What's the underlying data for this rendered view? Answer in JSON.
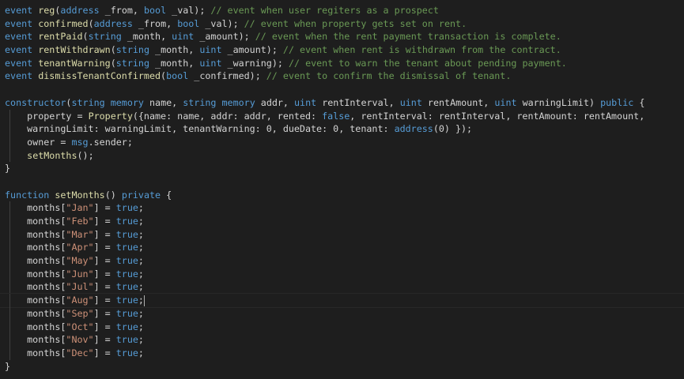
{
  "editor": {
    "lines": [
      {
        "tokens": [
          {
            "t": "event",
            "c": "kw"
          },
          {
            "t": " ",
            "c": "pl"
          },
          {
            "t": "reg",
            "c": "fn"
          },
          {
            "t": "(",
            "c": "pl"
          },
          {
            "t": "address",
            "c": "kw"
          },
          {
            "t": " _from, ",
            "c": "pl"
          },
          {
            "t": "bool",
            "c": "kw"
          },
          {
            "t": " _val); ",
            "c": "pl"
          },
          {
            "t": "// event when user regiters as a prospect",
            "c": "cm"
          }
        ]
      },
      {
        "tokens": [
          {
            "t": "event",
            "c": "kw"
          },
          {
            "t": " ",
            "c": "pl"
          },
          {
            "t": "confirmed",
            "c": "fn"
          },
          {
            "t": "(",
            "c": "pl"
          },
          {
            "t": "address",
            "c": "kw"
          },
          {
            "t": " _from, ",
            "c": "pl"
          },
          {
            "t": "bool",
            "c": "kw"
          },
          {
            "t": " _val); ",
            "c": "pl"
          },
          {
            "t": "// event when property gets set on rent.",
            "c": "cm"
          }
        ]
      },
      {
        "tokens": [
          {
            "t": "event",
            "c": "kw"
          },
          {
            "t": " ",
            "c": "pl"
          },
          {
            "t": "rentPaid",
            "c": "fn"
          },
          {
            "t": "(",
            "c": "pl"
          },
          {
            "t": "string",
            "c": "kw"
          },
          {
            "t": " _month, ",
            "c": "pl"
          },
          {
            "t": "uint",
            "c": "kw"
          },
          {
            "t": " _amount); ",
            "c": "pl"
          },
          {
            "t": "// event when the rent payment transaction is complete.",
            "c": "cm"
          }
        ]
      },
      {
        "tokens": [
          {
            "t": "event",
            "c": "kw"
          },
          {
            "t": " ",
            "c": "pl"
          },
          {
            "t": "rentWithdrawn",
            "c": "fn"
          },
          {
            "t": "(",
            "c": "pl"
          },
          {
            "t": "string",
            "c": "kw"
          },
          {
            "t": " _month, ",
            "c": "pl"
          },
          {
            "t": "uint",
            "c": "kw"
          },
          {
            "t": " _amount); ",
            "c": "pl"
          },
          {
            "t": "// event when rent is withdrawn from the contract.",
            "c": "cm"
          }
        ]
      },
      {
        "tokens": [
          {
            "t": "event",
            "c": "kw"
          },
          {
            "t": " ",
            "c": "pl"
          },
          {
            "t": "tenantWarning",
            "c": "fn"
          },
          {
            "t": "(",
            "c": "pl"
          },
          {
            "t": "string",
            "c": "kw"
          },
          {
            "t": " _month, ",
            "c": "pl"
          },
          {
            "t": "uint",
            "c": "kw"
          },
          {
            "t": " _warning); ",
            "c": "pl"
          },
          {
            "t": "// event to warn the tenant about pending payment.",
            "c": "cm"
          }
        ]
      },
      {
        "tokens": [
          {
            "t": "event",
            "c": "kw"
          },
          {
            "t": " ",
            "c": "pl"
          },
          {
            "t": "dismissTenantConfirmed",
            "c": "fn"
          },
          {
            "t": "(",
            "c": "pl"
          },
          {
            "t": "bool",
            "c": "kw"
          },
          {
            "t": " _confirmed); ",
            "c": "pl"
          },
          {
            "t": "// event to confirm the dismissal of tenant.",
            "c": "cm"
          }
        ]
      },
      {
        "tokens": []
      },
      {
        "tokens": [
          {
            "t": "constructor",
            "c": "kw"
          },
          {
            "t": "(",
            "c": "pl"
          },
          {
            "t": "string",
            "c": "kw"
          },
          {
            "t": " ",
            "c": "pl"
          },
          {
            "t": "memory",
            "c": "kw"
          },
          {
            "t": " name, ",
            "c": "pl"
          },
          {
            "t": "string",
            "c": "kw"
          },
          {
            "t": " ",
            "c": "pl"
          },
          {
            "t": "memory",
            "c": "kw"
          },
          {
            "t": " addr, ",
            "c": "pl"
          },
          {
            "t": "uint",
            "c": "kw"
          },
          {
            "t": " rentInterval, ",
            "c": "pl"
          },
          {
            "t": "uint",
            "c": "kw"
          },
          {
            "t": " rentAmount, ",
            "c": "pl"
          },
          {
            "t": "uint",
            "c": "kw"
          },
          {
            "t": " warningLimit) ",
            "c": "pl"
          },
          {
            "t": "public",
            "c": "kw"
          },
          {
            "t": " {",
            "c": "pl"
          }
        ]
      },
      {
        "indent": true,
        "tokens": [
          {
            "t": "    property = ",
            "c": "pl"
          },
          {
            "t": "Property",
            "c": "fn"
          },
          {
            "t": "({name: name, addr: addr, rented: ",
            "c": "pl"
          },
          {
            "t": "false",
            "c": "kw"
          },
          {
            "t": ", rentInterval: rentInterval, rentAmount: rentAmount,",
            "c": "pl"
          }
        ]
      },
      {
        "indent": true,
        "tokens": [
          {
            "t": "    warningLimit: warningLimit, tenantWarning: 0, dueDate: 0, tenant: ",
            "c": "pl"
          },
          {
            "t": "address",
            "c": "kw"
          },
          {
            "t": "(0) });",
            "c": "pl"
          }
        ]
      },
      {
        "indent": true,
        "tokens": [
          {
            "t": "    owner = ",
            "c": "pl"
          },
          {
            "t": "msg",
            "c": "kw"
          },
          {
            "t": ".sender;",
            "c": "pl"
          }
        ]
      },
      {
        "indent": true,
        "tokens": [
          {
            "t": "    ",
            "c": "pl"
          },
          {
            "t": "setMonths",
            "c": "fn"
          },
          {
            "t": "();",
            "c": "pl"
          }
        ]
      },
      {
        "tokens": [
          {
            "t": "}",
            "c": "pl"
          }
        ]
      },
      {
        "tokens": []
      },
      {
        "tokens": [
          {
            "t": "function",
            "c": "kw"
          },
          {
            "t": " ",
            "c": "pl"
          },
          {
            "t": "setMonths",
            "c": "fn"
          },
          {
            "t": "() ",
            "c": "pl"
          },
          {
            "t": "private",
            "c": "kw"
          },
          {
            "t": " {",
            "c": "pl"
          }
        ]
      },
      {
        "indent": true,
        "tokens": [
          {
            "t": "    months[",
            "c": "pl"
          },
          {
            "t": "\"Jan\"",
            "c": "st"
          },
          {
            "t": "] = ",
            "c": "pl"
          },
          {
            "t": "true",
            "c": "kw"
          },
          {
            "t": ";",
            "c": "pl"
          }
        ]
      },
      {
        "indent": true,
        "tokens": [
          {
            "t": "    months[",
            "c": "pl"
          },
          {
            "t": "\"Feb\"",
            "c": "st"
          },
          {
            "t": "] = ",
            "c": "pl"
          },
          {
            "t": "true",
            "c": "kw"
          },
          {
            "t": ";",
            "c": "pl"
          }
        ]
      },
      {
        "indent": true,
        "tokens": [
          {
            "t": "    months[",
            "c": "pl"
          },
          {
            "t": "\"Mar\"",
            "c": "st"
          },
          {
            "t": "] = ",
            "c": "pl"
          },
          {
            "t": "true",
            "c": "kw"
          },
          {
            "t": ";",
            "c": "pl"
          }
        ]
      },
      {
        "indent": true,
        "tokens": [
          {
            "t": "    months[",
            "c": "pl"
          },
          {
            "t": "\"Apr\"",
            "c": "st"
          },
          {
            "t": "] = ",
            "c": "pl"
          },
          {
            "t": "true",
            "c": "kw"
          },
          {
            "t": ";",
            "c": "pl"
          }
        ]
      },
      {
        "indent": true,
        "tokens": [
          {
            "t": "    months[",
            "c": "pl"
          },
          {
            "t": "\"May\"",
            "c": "st"
          },
          {
            "t": "] = ",
            "c": "pl"
          },
          {
            "t": "true",
            "c": "kw"
          },
          {
            "t": ";",
            "c": "pl"
          }
        ]
      },
      {
        "indent": true,
        "tokens": [
          {
            "t": "    months[",
            "c": "pl"
          },
          {
            "t": "\"Jun\"",
            "c": "st"
          },
          {
            "t": "] = ",
            "c": "pl"
          },
          {
            "t": "true",
            "c": "kw"
          },
          {
            "t": ";",
            "c": "pl"
          }
        ]
      },
      {
        "indent": true,
        "tokens": [
          {
            "t": "    months[",
            "c": "pl"
          },
          {
            "t": "\"Jul\"",
            "c": "st"
          },
          {
            "t": "] = ",
            "c": "pl"
          },
          {
            "t": "true",
            "c": "kw"
          },
          {
            "t": ";",
            "c": "pl"
          }
        ]
      },
      {
        "indent": true,
        "current": true,
        "cursor_after": true,
        "tokens": [
          {
            "t": "    months[",
            "c": "pl"
          },
          {
            "t": "\"Aug\"",
            "c": "st"
          },
          {
            "t": "] = ",
            "c": "pl"
          },
          {
            "t": "true",
            "c": "kw"
          },
          {
            "t": ";",
            "c": "pl"
          }
        ]
      },
      {
        "indent": true,
        "tokens": [
          {
            "t": "    months[",
            "c": "pl"
          },
          {
            "t": "\"Sep\"",
            "c": "st"
          },
          {
            "t": "] = ",
            "c": "pl"
          },
          {
            "t": "true",
            "c": "kw"
          },
          {
            "t": ";",
            "c": "pl"
          }
        ]
      },
      {
        "indent": true,
        "tokens": [
          {
            "t": "    months[",
            "c": "pl"
          },
          {
            "t": "\"Oct\"",
            "c": "st"
          },
          {
            "t": "] = ",
            "c": "pl"
          },
          {
            "t": "true",
            "c": "kw"
          },
          {
            "t": ";",
            "c": "pl"
          }
        ]
      },
      {
        "indent": true,
        "tokens": [
          {
            "t": "    months[",
            "c": "pl"
          },
          {
            "t": "\"Nov\"",
            "c": "st"
          },
          {
            "t": "] = ",
            "c": "pl"
          },
          {
            "t": "true",
            "c": "kw"
          },
          {
            "t": ";",
            "c": "pl"
          }
        ]
      },
      {
        "indent": true,
        "tokens": [
          {
            "t": "    months[",
            "c": "pl"
          },
          {
            "t": "\"Dec\"",
            "c": "st"
          },
          {
            "t": "] = ",
            "c": "pl"
          },
          {
            "t": "true",
            "c": "kw"
          },
          {
            "t": ";",
            "c": "pl"
          }
        ]
      },
      {
        "tokens": [
          {
            "t": "}",
            "c": "pl"
          }
        ]
      }
    ]
  }
}
